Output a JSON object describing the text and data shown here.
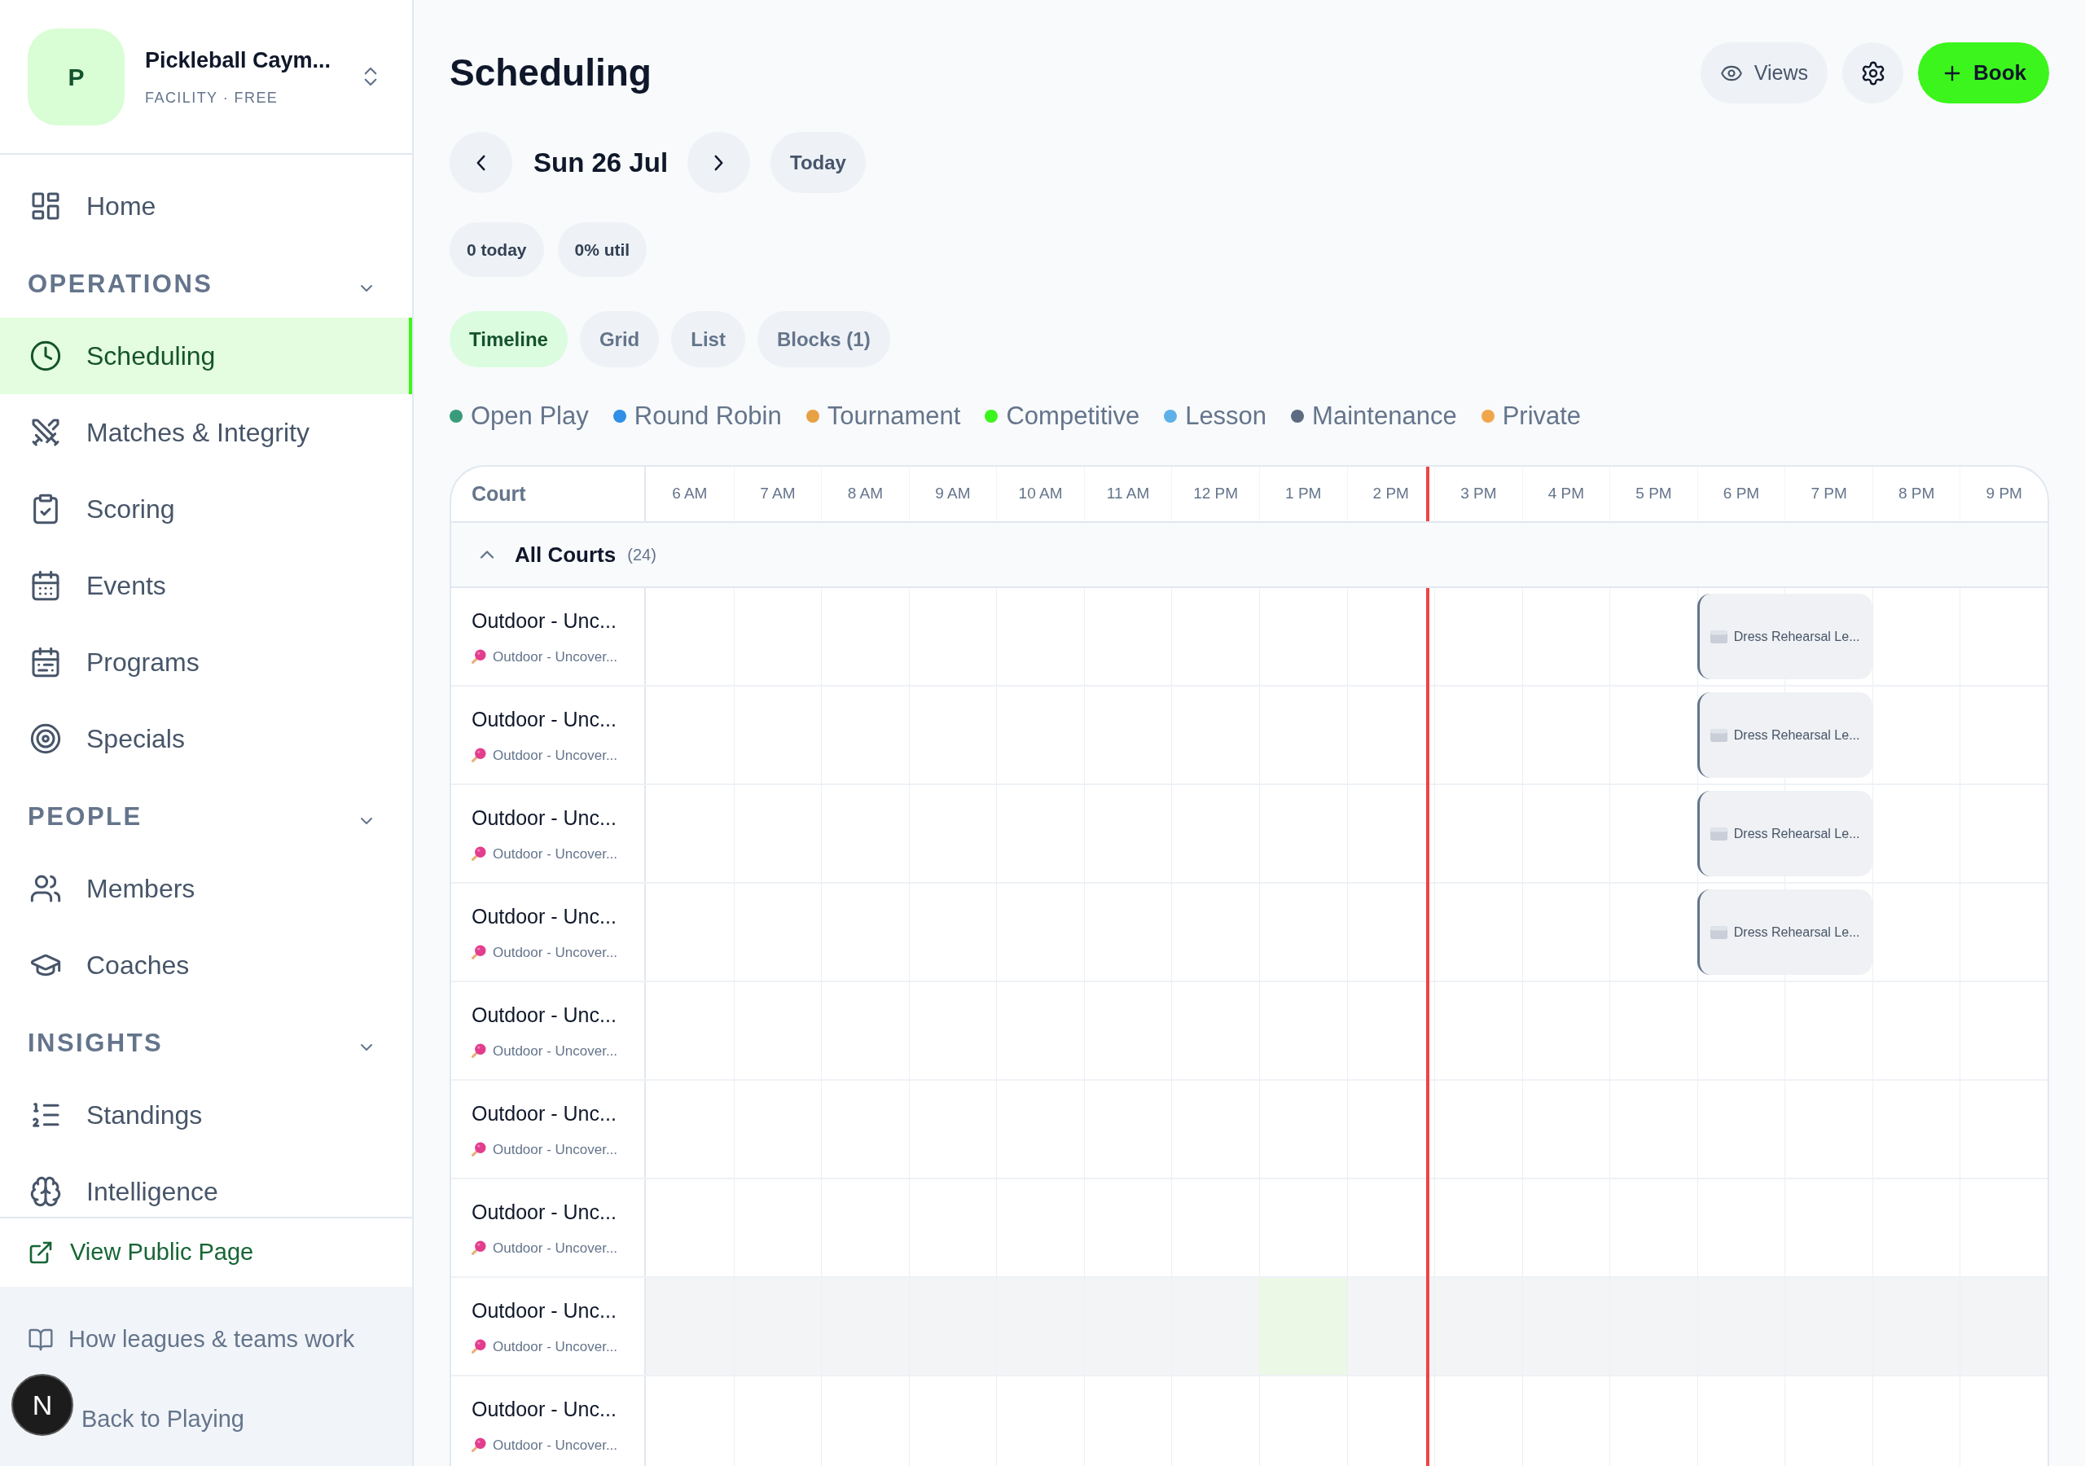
{
  "sidebar": {
    "org": {
      "initial": "P",
      "name": "Pickleball Caym...",
      "plan": "FACILITY · FREE"
    },
    "nav": [
      {
        "label": "Home",
        "selected": false
      }
    ],
    "sections": [
      {
        "title": "OPERATIONS",
        "expanded": true,
        "items": [
          {
            "label": "Scheduling",
            "selected": true
          },
          {
            "label": "Matches & Integrity",
            "selected": false
          },
          {
            "label": "Scoring",
            "selected": false
          },
          {
            "label": "Events",
            "selected": false
          },
          {
            "label": "Programs",
            "selected": false
          },
          {
            "label": "Specials",
            "selected": false
          }
        ]
      },
      {
        "title": "PEOPLE",
        "expanded": true,
        "items": [
          {
            "label": "Members",
            "selected": false
          },
          {
            "label": "Coaches",
            "selected": false
          }
        ]
      },
      {
        "title": "INSIGHTS",
        "expanded": true,
        "items": [
          {
            "label": "Standings",
            "selected": false
          },
          {
            "label": "Intelligence",
            "selected": false
          }
        ]
      }
    ],
    "public_link": "View Public Page",
    "help_link": "How leagues & teams work",
    "back_link": "Back to Playing"
  },
  "dev_badge": "N",
  "header": {
    "title": "Scheduling",
    "views": "Views",
    "book": "Book"
  },
  "date_nav": {
    "date": "Sun 26 Jul",
    "today": "Today"
  },
  "stats": [
    "0 today",
    "0% util"
  ],
  "view_tabs": [
    {
      "label": "Timeline",
      "selected": true
    },
    {
      "label": "Grid",
      "selected": false
    },
    {
      "label": "List",
      "selected": false
    },
    {
      "label": "Blocks (1)",
      "selected": false
    }
  ],
  "legend": [
    {
      "label": "Open Play",
      "color": "#3a9b7a"
    },
    {
      "label": "Round Robin",
      "color": "#2f8fe6"
    },
    {
      "label": "Tournament",
      "color": "#e8a045"
    },
    {
      "label": "Competitive",
      "color": "#3cf51c"
    },
    {
      "label": "Lesson",
      "color": "#5fb0e8"
    },
    {
      "label": "Maintenance",
      "color": "#5d6b82"
    },
    {
      "label": "Private",
      "color": "#f0a64d"
    }
  ],
  "timeline": {
    "court_header": "Court",
    "hours": [
      "6 AM",
      "7 AM",
      "8 AM",
      "9 AM",
      "10 AM",
      "11 AM",
      "12 PM",
      "1 PM",
      "2 PM",
      "3 PM",
      "4 PM",
      "5 PM",
      "6 PM",
      "7 PM",
      "8 PM",
      "9 PM"
    ],
    "now": {
      "level": 0.558
    },
    "group": {
      "label": "All Courts",
      "count": "(24)",
      "expanded": true
    },
    "courts": [
      {
        "name": "Outdoor - Unc...",
        "type": "Outdoor - Uncover...",
        "hovered": false,
        "slots": [
          {
            "kind": "free"
          },
          {
            "kind": "free"
          },
          {
            "kind": "free"
          },
          {
            "kind": "free"
          },
          {
            "kind": "free"
          },
          {
            "kind": "free"
          },
          {
            "kind": "free"
          },
          {
            "kind": "free"
          },
          {
            "kind": "free"
          },
          {
            "kind": "free"
          },
          {
            "kind": "free"
          },
          {
            "kind": "free"
          },
          {
            "kind": "booking",
            "title": "Dress Rehearsal Le..."
          },
          {
            "kind": "continued"
          },
          {
            "kind": "free"
          },
          {
            "kind": "free"
          }
        ]
      },
      {
        "name": "Outdoor - Unc...",
        "type": "Outdoor - Uncover...",
        "hovered": false,
        "slots": [
          {
            "kind": "free"
          },
          {
            "kind": "free"
          },
          {
            "kind": "free"
          },
          {
            "kind": "free"
          },
          {
            "kind": "free"
          },
          {
            "kind": "free"
          },
          {
            "kind": "free"
          },
          {
            "kind": "free"
          },
          {
            "kind": "free"
          },
          {
            "kind": "free"
          },
          {
            "kind": "free"
          },
          {
            "kind": "free"
          },
          {
            "kind": "booking",
            "title": "Dress Rehearsal Le..."
          },
          {
            "kind": "continued"
          },
          {
            "kind": "free"
          },
          {
            "kind": "free"
          }
        ]
      },
      {
        "name": "Outdoor - Unc...",
        "type": "Outdoor - Uncover...",
        "hovered": false,
        "slots": [
          {
            "kind": "free"
          },
          {
            "kind": "free"
          },
          {
            "kind": "free"
          },
          {
            "kind": "free"
          },
          {
            "kind": "free"
          },
          {
            "kind": "free"
          },
          {
            "kind": "free"
          },
          {
            "kind": "free"
          },
          {
            "kind": "free"
          },
          {
            "kind": "free"
          },
          {
            "kind": "free"
          },
          {
            "kind": "free"
          },
          {
            "kind": "booking",
            "title": "Dress Rehearsal Le..."
          },
          {
            "kind": "continued"
          },
          {
            "kind": "free"
          },
          {
            "kind": "free"
          }
        ]
      },
      {
        "name": "Outdoor - Unc...",
        "type": "Outdoor - Uncover...",
        "hovered": false,
        "slots": [
          {
            "kind": "free"
          },
          {
            "kind": "free"
          },
          {
            "kind": "free"
          },
          {
            "kind": "free"
          },
          {
            "kind": "free"
          },
          {
            "kind": "free"
          },
          {
            "kind": "free"
          },
          {
            "kind": "free"
          },
          {
            "kind": "free"
          },
          {
            "kind": "free"
          },
          {
            "kind": "free"
          },
          {
            "kind": "free"
          },
          {
            "kind": "booking",
            "title": "Dress Rehearsal Le..."
          },
          {
            "kind": "continued"
          },
          {
            "kind": "free"
          },
          {
            "kind": "free"
          }
        ]
      },
      {
        "name": "Outdoor - Unc...",
        "type": "Outdoor - Uncover...",
        "hovered": false,
        "slots": [
          {
            "kind": "free"
          },
          {
            "kind": "free"
          },
          {
            "kind": "free"
          },
          {
            "kind": "free"
          },
          {
            "kind": "free"
          },
          {
            "kind": "free"
          },
          {
            "kind": "free"
          },
          {
            "kind": "free"
          },
          {
            "kind": "free"
          },
          {
            "kind": "free"
          },
          {
            "kind": "free"
          },
          {
            "kind": "free"
          },
          {
            "kind": "free"
          },
          {
            "kind": "free"
          },
          {
            "kind": "free"
          },
          {
            "kind": "free"
          }
        ]
      },
      {
        "name": "Outdoor - Unc...",
        "type": "Outdoor - Uncover...",
        "hovered": false,
        "slots": [
          {
            "kind": "free"
          },
          {
            "kind": "free"
          },
          {
            "kind": "free"
          },
          {
            "kind": "free"
          },
          {
            "kind": "free"
          },
          {
            "kind": "free"
          },
          {
            "kind": "free"
          },
          {
            "kind": "free"
          },
          {
            "kind": "free"
          },
          {
            "kind": "free"
          },
          {
            "kind": "free"
          },
          {
            "kind": "free"
          },
          {
            "kind": "free"
          },
          {
            "kind": "free"
          },
          {
            "kind": "free"
          },
          {
            "kind": "free"
          }
        ]
      },
      {
        "name": "Outdoor - Unc...",
        "type": "Outdoor - Uncover...",
        "hovered": false,
        "slots": [
          {
            "kind": "free"
          },
          {
            "kind": "free"
          },
          {
            "kind": "free"
          },
          {
            "kind": "free"
          },
          {
            "kind": "free"
          },
          {
            "kind": "free"
          },
          {
            "kind": "free"
          },
          {
            "kind": "free"
          },
          {
            "kind": "free"
          },
          {
            "kind": "free"
          },
          {
            "kind": "free"
          },
          {
            "kind": "free"
          },
          {
            "kind": "free"
          },
          {
            "kind": "free"
          },
          {
            "kind": "free"
          },
          {
            "kind": "free"
          }
        ]
      },
      {
        "name": "Outdoor - Unc...",
        "type": "Outdoor - Uncover...",
        "hovered": true,
        "slots": [
          {
            "kind": "free"
          },
          {
            "kind": "free"
          },
          {
            "kind": "free"
          },
          {
            "kind": "free"
          },
          {
            "kind": "free"
          },
          {
            "kind": "free"
          },
          {
            "kind": "free"
          },
          {
            "kind": "hover"
          },
          {
            "kind": "free"
          },
          {
            "kind": "free"
          },
          {
            "kind": "free"
          },
          {
            "kind": "free"
          },
          {
            "kind": "free"
          },
          {
            "kind": "free"
          },
          {
            "kind": "free"
          },
          {
            "kind": "free"
          }
        ]
      },
      {
        "name": "Outdoor - Unc...",
        "type": "Outdoor - Uncover...",
        "hovered": false,
        "slots": [
          {
            "kind": "free"
          },
          {
            "kind": "free"
          },
          {
            "kind": "free"
          },
          {
            "kind": "free"
          },
          {
            "kind": "free"
          },
          {
            "kind": "free"
          },
          {
            "kind": "free"
          },
          {
            "kind": "free"
          },
          {
            "kind": "free"
          },
          {
            "kind": "free"
          },
          {
            "kind": "free"
          },
          {
            "kind": "free"
          },
          {
            "kind": "free"
          },
          {
            "kind": "free"
          },
          {
            "kind": "free"
          },
          {
            "kind": "free"
          }
        ]
      }
    ]
  }
}
